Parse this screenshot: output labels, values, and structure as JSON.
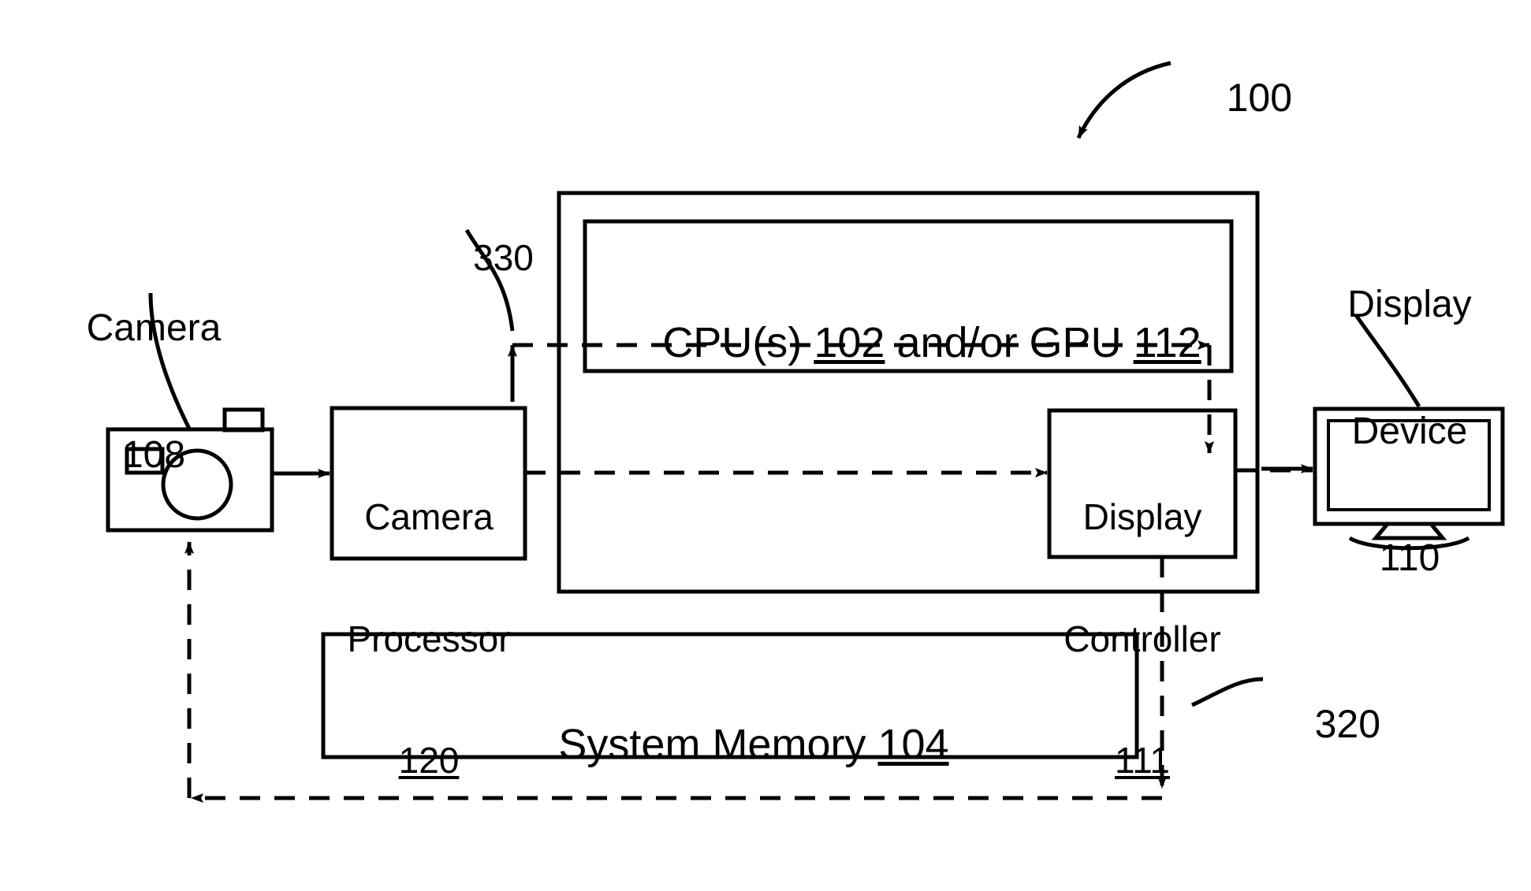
{
  "figure": {
    "system_ref": "100",
    "dataflow_refs": {
      "to_camera_processor": "330",
      "to_camera": "320"
    }
  },
  "blocks": {
    "camera": {
      "title": "Camera",
      "ref": "108",
      "icon": "camera-icon"
    },
    "camera_processor": {
      "line1": "Camera",
      "line2": "Processor",
      "ref": "120"
    },
    "processing_unit": {
      "prefix": "CPU(s)",
      "ref_cpu": "102",
      "middle": "and/or GPU",
      "ref_gpu": "112"
    },
    "display_controller": {
      "line1": "Display",
      "line2": "Controller",
      "ref": "111"
    },
    "display_device": {
      "line1": "Display",
      "line2": "Device",
      "ref": "110",
      "icon": "monitor-icon"
    },
    "system_memory": {
      "label": "System Memory",
      "ref": "104"
    }
  },
  "colors": {
    "stroke": "#000000",
    "background": "#ffffff"
  }
}
